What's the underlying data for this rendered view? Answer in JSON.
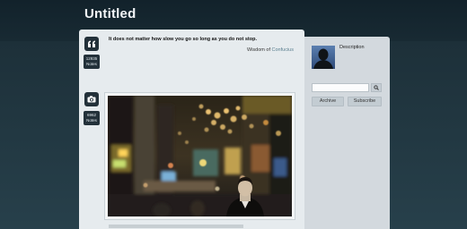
{
  "blog": {
    "title": "Untitled"
  },
  "posts": [
    {
      "type": "quote",
      "icon": "quote-icon",
      "notes_count": "12935",
      "notes_label": "Notes",
      "quote": "It does not matter how slow you go so long as you do not stop.",
      "source_prefix": "Wisdom of",
      "source_link": "Confucius"
    },
    {
      "type": "photo",
      "icon": "camera-icon",
      "notes_count": "6962",
      "notes_label": "Notes",
      "photo": "night-city-street-bokeh"
    }
  ],
  "sidebar": {
    "avatar": "avatar-silhouette",
    "description": "Description",
    "search_placeholder": "",
    "search_icon": "search-icon",
    "archive_label": "Archive",
    "subscribe_label": "Subscribe"
  },
  "colors": {
    "background": "#1f2e36",
    "content": "#e6ebee",
    "sidebar": "#d3d9de",
    "link": "#5a7f8f"
  }
}
